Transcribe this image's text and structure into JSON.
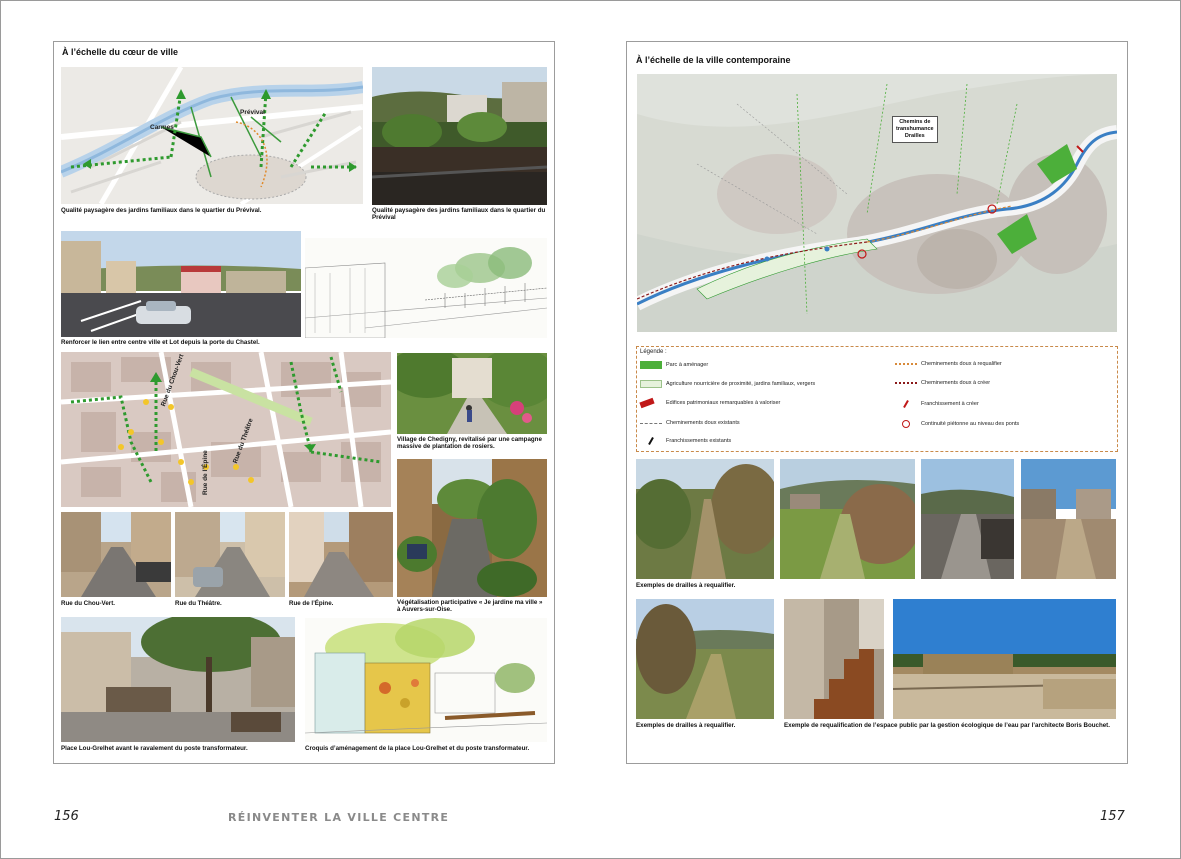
{
  "footer": {
    "left_folio": "156",
    "running_title": "RÉINVENTER LA VILLE CENTRE",
    "right_folio": "157"
  },
  "left_page": {
    "title": "À l’échelle du cœur de ville",
    "map1_labels": {
      "carmes": "Carmes",
      "previval": "Prévival"
    },
    "map2_labels": {
      "chou_vert": "Rue du Chou-Vert",
      "theatre": "Rue du Théâtre",
      "epine": "Rue de l’Épine"
    },
    "captions": {
      "c1": "Qualité paysagère des jardins familiaux dans le quartier du Prévival.",
      "c2": "Qualité paysagère des jardins familiaux dans le quartier du Prévival",
      "c3": "Renforcer le lien entre centre ville et Lot depuis la porte du Chastel.",
      "c4": "Village de Chedigny, revitalisé par une campagne massive de plantation de rosiers.",
      "c5": "Rue du Chou-Vert.",
      "c6": "Rue du Théâtre.",
      "c7": "Rue de l’Épine.",
      "c8": "Végétalisation participative « Je jardine ma ville » à Auvers-sur-Oise.",
      "c9": "Place Lou-Grelhet avant le ravalement du poste transformateur.",
      "c10": "Croquis d’aménagement de la place Lou-Grelhet et du poste transformateur."
    }
  },
  "right_page": {
    "title": "À l’échelle de la ville contemporaine",
    "callout": [
      "Chemins de",
      "transhumance",
      "Drailles"
    ],
    "legend": {
      "title": "Légende :",
      "items": [
        "Parc à aménager",
        "Agriculture nourricière de proximité, jardins familiaux, vergers",
        "Edifices patrimoniaux remarquables à valoriser",
        "Cheminements doux existants",
        "Franchissements existants",
        "Cheminements doux à requalifier",
        "Cheminements doux à créer",
        "Franchissement à créer",
        "Continuité piétonne au niveau des ponts"
      ]
    },
    "captions": {
      "c1": "Exemples de drailles à requalifier.",
      "c2": "Exemples de drailles à requalifier.",
      "c3": "Exemple de requalification de l’espace public par la gestion écologique de l’eau par l’architecte Boris Bouchet."
    }
  },
  "colors": {
    "park": "#4caf3a",
    "agri": "#e6f2dc",
    "heritage": "#c01818",
    "path_existing": "#777777",
    "path_requalify": "#d88a3a",
    "path_create": "#8b1a1a",
    "river": "#3a7fc4",
    "green_path": "#2e9a2e"
  }
}
